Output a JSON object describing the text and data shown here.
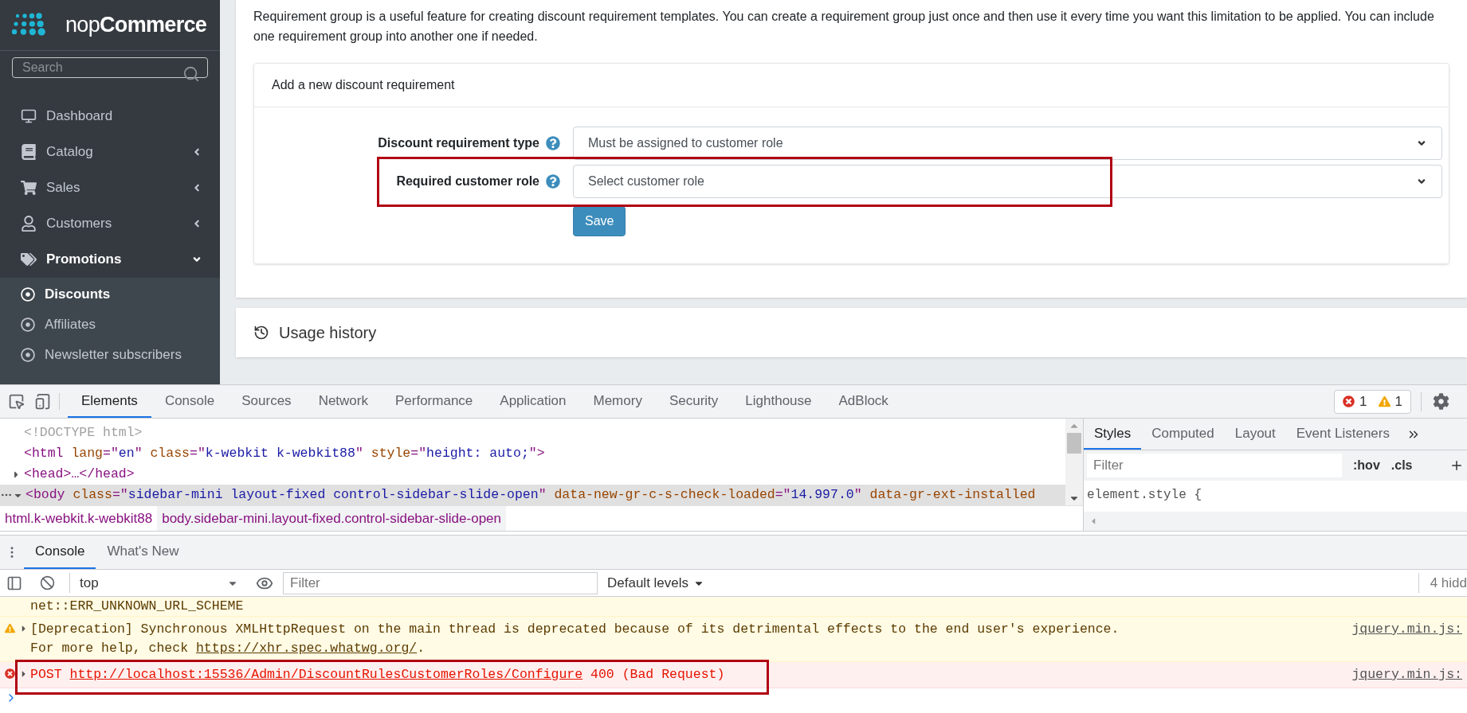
{
  "sidebar": {
    "logo": "nop**Commerce**",
    "search": {
      "placeholder": "Search"
    },
    "items": [
      {
        "label": "Dashboard",
        "selected": false
      },
      {
        "label": "Catalog",
        "selected": false,
        "expanded": false
      },
      {
        "label": "Sales",
        "selected": false,
        "expanded": false
      },
      {
        "label": "Customers",
        "selected": false,
        "expanded": false
      },
      {
        "label": "Promotions",
        "selected": true,
        "expanded": true,
        "children": [
          {
            "label": "Discounts",
            "selected": true
          },
          {
            "label": "Affiliates",
            "selected": false
          },
          {
            "label": "Newsletter subscribers",
            "selected": false
          }
        ]
      }
    ]
  },
  "page": {
    "intro": "Requirement group is a useful feature for creating discount requirement templates. You can create a requirement group just once and then use it every time you want this limitation to be applied. You can include one requirement group into another one if needed.",
    "requirement_card": {
      "title": "Add a new discount requirement",
      "fields": [
        {
          "label": "Discount requirement type",
          "value": "Must be assigned to customer role",
          "highlighted": false
        },
        {
          "label": "Required customer role",
          "value": "Select customer role",
          "highlighted": true
        }
      ],
      "button": "Save"
    },
    "usage_card": {
      "title": "Usage history"
    }
  },
  "devtools": {
    "tabs": [
      {
        "label": "Elements",
        "selected": true
      },
      {
        "label": "Console",
        "selected": false
      },
      {
        "label": "Sources",
        "selected": false
      },
      {
        "label": "Network",
        "selected": false
      },
      {
        "label": "Performance",
        "selected": false
      },
      {
        "label": "Application",
        "selected": false
      },
      {
        "label": "Memory",
        "selected": false
      },
      {
        "label": "Security",
        "selected": false
      },
      {
        "label": "Lighthouse",
        "selected": false
      },
      {
        "label": "AdBlock",
        "selected": false
      }
    ],
    "errors": "1",
    "warnings": "1",
    "dom_lines": [
      {
        "selected": false,
        "tokens": [
          {
            "kind": "comment",
            "text": "<!DOCTYPE html>"
          }
        ]
      },
      {
        "selected": false,
        "tokens": [
          {
            "kind": "tag",
            "text": "<html"
          },
          {
            "kind": "attr",
            "text": " lang"
          },
          {
            "kind": "plain",
            "text": "=\""
          },
          {
            "kind": "value",
            "text": "en"
          },
          {
            "kind": "plain",
            "text": "\""
          },
          {
            "kind": "attr",
            "text": " class"
          },
          {
            "kind": "plain",
            "text": "=\""
          },
          {
            "kind": "value",
            "text": "k-webkit k-webkit88"
          },
          {
            "kind": "plain",
            "text": "\""
          },
          {
            "kind": "attr",
            "text": " style"
          },
          {
            "kind": "plain",
            "text": "=\""
          },
          {
            "kind": "value",
            "text": "height: auto;"
          },
          {
            "kind": "plain",
            "text": "\""
          },
          {
            "kind": "tag",
            "text": ">"
          }
        ]
      },
      {
        "expanded": false,
        "selected": false,
        "tokens": [
          {
            "kind": "tag",
            "text": "<head>"
          },
          {
            "kind": "plain",
            "text": "…"
          },
          {
            "kind": "tag",
            "text": "</head>"
          }
        ]
      },
      {
        "expanded": true,
        "selected": true,
        "tokens": [
          {
            "kind": "tag",
            "text": "<body"
          },
          {
            "kind": "attr",
            "text": " class"
          },
          {
            "kind": "plain",
            "text": "=\""
          },
          {
            "kind": "value",
            "text": "sidebar-mini layout-fixed control-sidebar-slide-open"
          },
          {
            "kind": "plain",
            "text": "\""
          },
          {
            "kind": "attr",
            "text": " data-new-gr-c-s-check-loaded"
          },
          {
            "kind": "plain",
            "text": "=\""
          },
          {
            "kind": "value",
            "text": "14.997.0"
          },
          {
            "kind": "plain",
            "text": "\""
          },
          {
            "kind": "attr",
            "text": " data-gr-ext-installed"
          }
        ]
      }
    ],
    "breadcrumbs": [
      {
        "label": "html.k-webkit.k-webkit88",
        "selected": false
      },
      {
        "label": "body.sidebar-mini.layout-fixed.control-sidebar-slide-open",
        "selected": true
      }
    ],
    "styles_tabs": [
      {
        "label": "Styles",
        "selected": true
      },
      {
        "label": "Computed",
        "selected": false
      },
      {
        "label": "Layout",
        "selected": false
      },
      {
        "label": "Event Listeners",
        "selected": false
      }
    ],
    "styles_filter": {
      "placeholder": "Filter"
    },
    "hov": ":hov",
    "cls": ".cls",
    "rule": "element.style {",
    "drawer_tabs": [
      {
        "label": "Console",
        "selected": true
      },
      {
        "label": "What's New",
        "selected": false
      }
    ],
    "console": {
      "context": "top",
      "filter": {
        "placeholder": "Filter"
      },
      "levels": "Default levels",
      "hidden": "4 hidd",
      "messages": [
        {
          "kind": "warning",
          "continued": true,
          "collapsed": false,
          "highlighted": false,
          "before": "net::ERR_UNKNOWN_URL_SCHEME"
        },
        {
          "kind": "warning",
          "continued": false,
          "collapsed": true,
          "highlighted": false,
          "before": "[Deprecation] Synchronous XMLHttpRequest on the main thread is deprecated because of its detrimental effects to the end user's experience. For more help, check ",
          "link": "https://xhr.spec.whatwg.org/",
          "after": ".",
          "source": "jquery.min.js:"
        },
        {
          "kind": "error",
          "continued": false,
          "collapsed": true,
          "highlighted": true,
          "before": "POST ",
          "link": "http://localhost:15536/Admin/DiscountRulesCustomerRoles/Configure",
          "after": " 400 (Bad Request)",
          "source": "jquery.min.js:"
        }
      ]
    }
  }
}
